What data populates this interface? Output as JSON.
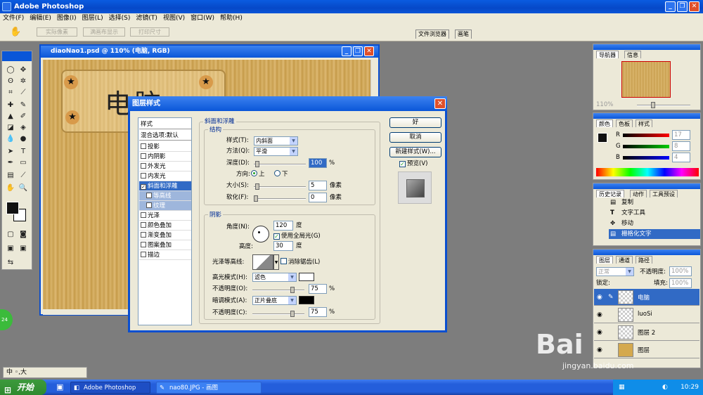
{
  "app": {
    "title": "Adobe Photoshop"
  },
  "menu": [
    "文件(F)",
    "编辑(E)",
    "图像(I)",
    "图层(L)",
    "选择(S)",
    "滤镜(T)",
    "视图(V)",
    "窗口(W)",
    "帮助(H)"
  ],
  "options": {
    "actual_pixels": "实际像素",
    "fit_screen": "满画布显示",
    "print_size": "打印尺寸"
  },
  "palette_well": {
    "file_browser": "文件浏览器",
    "brushes": "画笔"
  },
  "document": {
    "title": "diaoNao1.psd @ 110% (电脑, RGB)",
    "sign_text": "电脑"
  },
  "dialog": {
    "title": "图层样式",
    "styles_header": "样式",
    "blend_options": "混合选项:默认",
    "items": [
      {
        "label": "投影",
        "checked": false
      },
      {
        "label": "内阴影",
        "checked": false
      },
      {
        "label": "外发光",
        "checked": false
      },
      {
        "label": "内发光",
        "checked": false
      },
      {
        "label": "斜面和浮雕",
        "checked": true
      },
      {
        "label": "等高线",
        "checked": false,
        "sub": true
      },
      {
        "label": "纹理",
        "checked": false,
        "sub": true
      },
      {
        "label": "光泽",
        "checked": false
      },
      {
        "label": "颜色叠加",
        "checked": false
      },
      {
        "label": "渐变叠加",
        "checked": false
      },
      {
        "label": "图案叠加",
        "checked": false
      },
      {
        "label": "描边",
        "checked": false
      }
    ],
    "bevel_title": "斜面和浮雕",
    "structure": {
      "group": "结构",
      "style_label": "样式(T):",
      "style_value": "内斜面",
      "method_label": "方法(Q):",
      "method_value": "平滑",
      "depth_label": "深度(D):",
      "depth_value": "100",
      "depth_unit": "%",
      "direction_label": "方向:",
      "dir_up": "上",
      "dir_down": "下",
      "size_label": "大小(S):",
      "size_value": "5",
      "size_unit": "像素",
      "soften_label": "软化(F):",
      "soften_value": "0",
      "soften_unit": "像素"
    },
    "shading": {
      "group": "阴影",
      "angle_label": "角度(N):",
      "angle_value": "120",
      "angle_unit": "度",
      "global_light": "使用全局光(G)",
      "altitude_label": "高度:",
      "altitude_value": "30",
      "altitude_unit": "度",
      "gloss_label": "光泽等高线:",
      "antialias": "消除锯齿(L)",
      "highlight_label": "高光模式(H):",
      "highlight_mode": "滤色",
      "hl_opacity_label": "不透明度(O):",
      "hl_opacity": "75",
      "pct": "%",
      "shadow_label": "暗调模式(A):",
      "shadow_mode": "正片叠底",
      "sh_opacity_label": "不透明度(C):",
      "sh_opacity": "75"
    },
    "buttons": {
      "ok": "好",
      "cancel": "取消",
      "new_style": "新建样式(W)...",
      "preview": "预览(V)"
    }
  },
  "navigator": {
    "tab1": "导航器",
    "tab2": "信息",
    "zoom": "110%"
  },
  "color": {
    "tab1": "颜色",
    "tab2": "色板",
    "tab3": "样式",
    "r": "R",
    "g": "G",
    "b": "B",
    "r_val": "17",
    "g_val": "8",
    "b_val": "4"
  },
  "history": {
    "tab1": "历史记录",
    "tab2": "动作",
    "tab3": "工具预设",
    "items": [
      "复制",
      "文字工具",
      "移动",
      "栅格化文字"
    ]
  },
  "layers": {
    "tab1": "图层",
    "tab2": "通道",
    "tab3": "路径",
    "mode": "正常",
    "opacity_label": "不透明度:",
    "opacity": "100%",
    "lock_label": "锁定:",
    "fill_label": "填充:",
    "fill": "100%",
    "rows": [
      "电脑",
      "luoSi",
      "图层 2",
      "图层"
    ]
  },
  "taskbar": {
    "start": "开始",
    "task1": "Adobe Photoshop",
    "task2": "nao80.JPG - 画图",
    "clock": "10:29"
  },
  "ime": "中 ◦,大",
  "badge": "24",
  "watermark": {
    "brand": "Bai",
    "url": "jingyan.baidu.com"
  },
  "colors": {
    "xp_blue": "#0a56d8",
    "face": "#ece9d8",
    "selected": "#316ac5"
  }
}
